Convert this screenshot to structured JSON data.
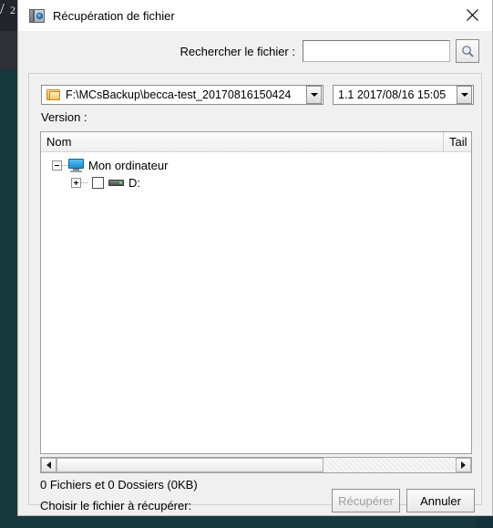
{
  "window": {
    "title": "Récupération de fichier",
    "icon": "backup-app-icon",
    "close_label": "×"
  },
  "search": {
    "label": "Rechercher le fichier :",
    "value": "",
    "placeholder": "",
    "button_icon": "search-icon"
  },
  "path": {
    "folder_icon": "folder-icon",
    "value": "F:\\MCsBackup\\becca-test_20170816150424",
    "dropdown_icon": "chevron-down-icon"
  },
  "version": {
    "value": "1.1  2017/08/16 15:05",
    "dropdown_icon": "chevron-down-icon",
    "label": "Version :"
  },
  "list": {
    "columns": [
      {
        "key": "nom",
        "label": "Nom"
      },
      {
        "key": "taille",
        "label": "Tail"
      }
    ],
    "tree": [
      {
        "level": 1,
        "expander": "minus",
        "icon": "computer-monitor-icon",
        "label": "Mon ordinateur",
        "checkbox": false
      },
      {
        "level": 2,
        "expander": "plus",
        "icon": "hard-drive-icon",
        "label": "D:",
        "checkbox": true
      }
    ]
  },
  "scrollbar": {
    "left_icon": "arrow-left-icon",
    "right_icon": "arrow-right-icon",
    "thumb_percent": 67
  },
  "footer": {
    "status": "0 Fichiers et 0 Dossiers (0KB)",
    "hint": "Choisir le fichier à récupérer:",
    "recover_label": "Récupérer",
    "recover_disabled": true,
    "cancel_label": "Annuler"
  },
  "colors": {
    "dialog_bg": "#f0f0f0",
    "titlebar_bg": "#ffffff",
    "desktop_dark": "#17383c",
    "desktop_green": "#1e8449",
    "disabled_text": "#9d9d9d"
  }
}
